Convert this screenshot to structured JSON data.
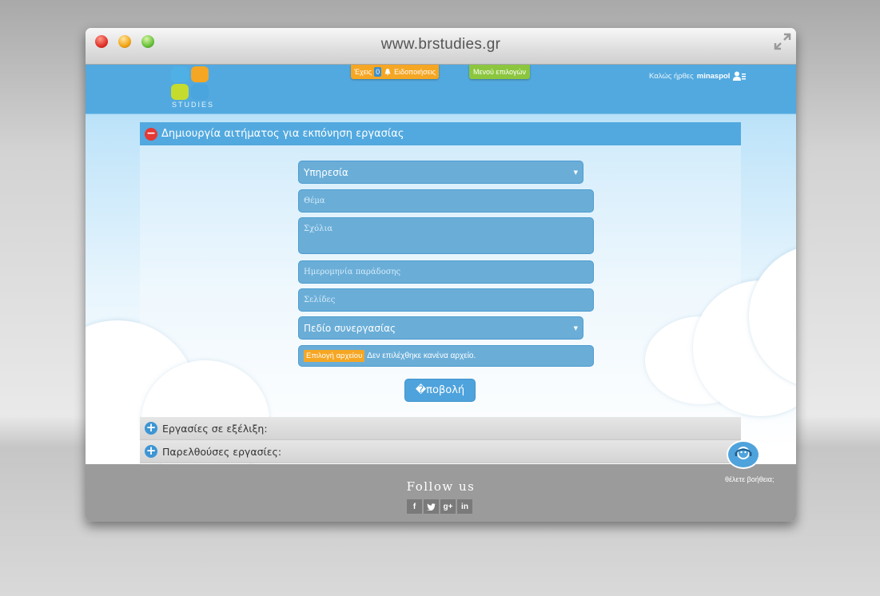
{
  "browser": {
    "url": "www.brstudies.gr"
  },
  "header": {
    "logo_text": "STUDIES",
    "notifications": {
      "prefix": "Έχεις",
      "count": "0",
      "label": "Ειδοποιήσεις"
    },
    "menu_label": "Μενού επιλογών",
    "welcome_text": "Καλώς ήρθες",
    "username": "minaspol"
  },
  "form_panel": {
    "title": "Δημιουργία αιτήματος για εκπόνηση εργασίας",
    "service_select": "Υπηρεσία",
    "subject_placeholder": "Θέμα",
    "comments_placeholder": "Σχόλια",
    "delivery_date_placeholder": "Ημερομηνία παράδοσης",
    "pages_placeholder": "Σελίδες",
    "field_select": "Πεδίο συνεργασίας",
    "file_button": "Επιλογή αρχείου",
    "file_status": "Δεν επιλέχθηκε κανένα αρχείο.",
    "submit_label": "�ποβολή"
  },
  "sections": [
    {
      "label": "Εργασίες σε εξέλιξη:"
    },
    {
      "label": "Παρελθούσες εργασίες:"
    }
  ],
  "footer": {
    "follow_label": "Follow us",
    "social": [
      "f",
      "t",
      "g+",
      "in"
    ],
    "help_text": "θέλετε βοήθεια;"
  },
  "colors": {
    "accent_blue": "#52a9df",
    "notif_orange": "#f5a623",
    "menu_green": "#8cc63f",
    "collapse_red": "#e53935",
    "footer_gray": "#9b9b9b"
  }
}
